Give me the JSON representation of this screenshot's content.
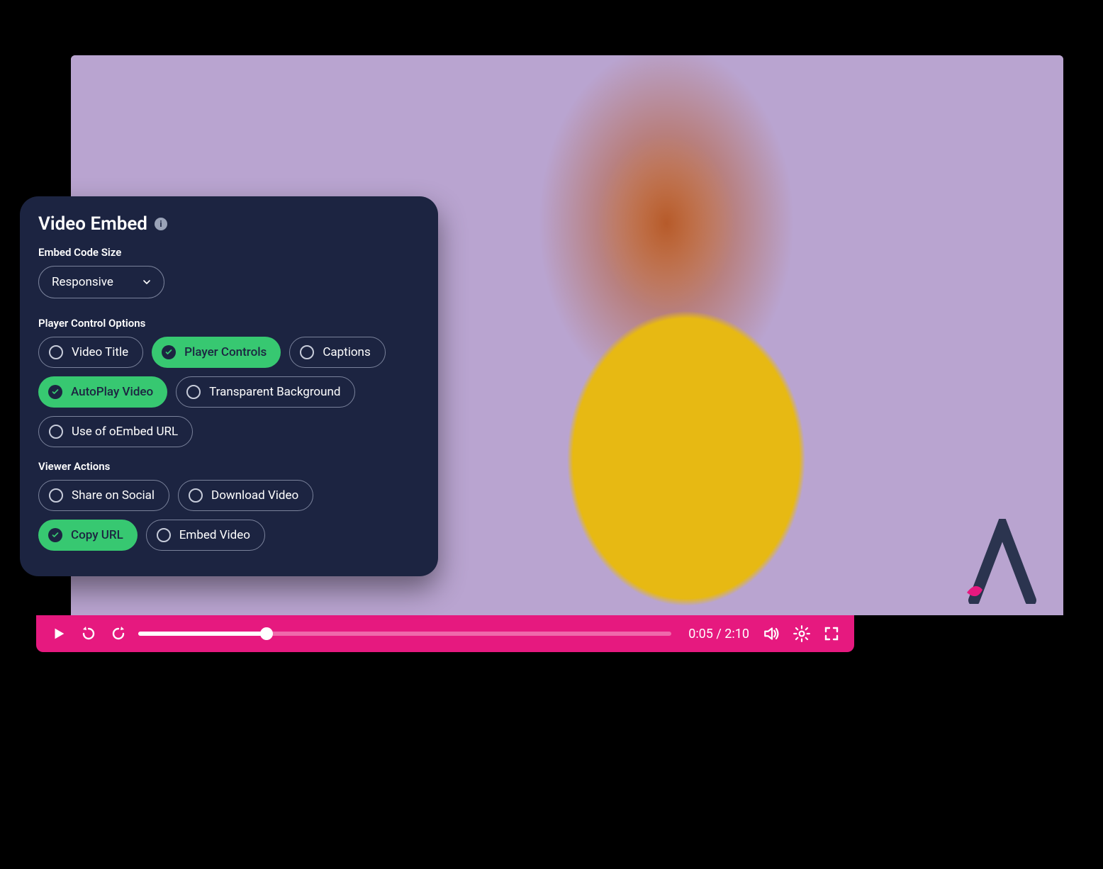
{
  "panel": {
    "title": "Video Embed",
    "size_section_label": "Embed Code Size",
    "size_select_value": "Responsive",
    "player_options_label": "Player Control Options",
    "player_options": [
      {
        "label": "Video Title",
        "selected": false
      },
      {
        "label": "Player Controls",
        "selected": true
      },
      {
        "label": "Captions",
        "selected": false
      },
      {
        "label": "AutoPlay Video",
        "selected": true
      },
      {
        "label": "Transparent Background",
        "selected": false
      },
      {
        "label": "Use of oEmbed URL",
        "selected": false
      }
    ],
    "viewer_actions_label": "Viewer Actions",
    "viewer_actions": [
      {
        "label": "Share on Social",
        "selected": false
      },
      {
        "label": "Download Video",
        "selected": false
      },
      {
        "label": "Copy URL",
        "selected": true
      },
      {
        "label": "Embed Video",
        "selected": false
      }
    ]
  },
  "player": {
    "current_time": "0:05",
    "duration": "2:10",
    "time_separator": " / ",
    "progress_percent": 24
  },
  "colors": {
    "panel_bg": "#1c2441",
    "accent_green": "#37c871",
    "player_bar": "#e6197f",
    "video_bg": "#b9a4d0"
  }
}
